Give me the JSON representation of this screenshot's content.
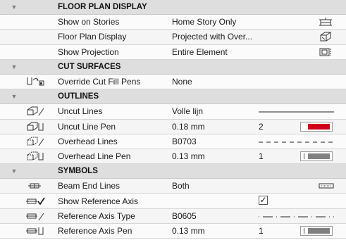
{
  "sections": [
    {
      "title": "FLOOR PLAN DISPLAY",
      "rows": [
        {
          "label": "Show on Stories",
          "value": "Home Story Only",
          "right_icon": "story-icon"
        },
        {
          "label": "Floor Plan Display",
          "value": "Projected with Over...",
          "right_icon": "projected-overhead-icon"
        },
        {
          "label": "Show Projection",
          "value": "Entire Element",
          "right_icon": "entire-element-icon"
        }
      ]
    },
    {
      "title": "CUT SURFACES",
      "rows": [
        {
          "label": "Override Cut Fill Pens",
          "value": "None",
          "left_icon": "override-fill-pens-icon"
        }
      ]
    },
    {
      "title": "OUTLINES",
      "rows": [
        {
          "label": "Uncut Lines",
          "value": "Volle lijn",
          "left_icon": "uncut-lines-icon",
          "line_style": "solid"
        },
        {
          "label": "Uncut Line Pen",
          "value": "0.18 mm",
          "left_icon": "uncut-line-pen-icon",
          "pen_number": "2",
          "pen_color": "#d0021b"
        },
        {
          "label": "Overhead Lines",
          "value": "B0703",
          "left_icon": "overhead-lines-icon",
          "line_style": "dashed"
        },
        {
          "label": "Overhead Line Pen",
          "value": "0.13 mm",
          "left_icon": "overhead-line-pen-icon",
          "pen_number": "1",
          "pen_color": "#808080"
        }
      ]
    },
    {
      "title": "SYMBOLS",
      "rows": [
        {
          "label": "Beam End Lines",
          "value": "Both",
          "left_icon": "beam-end-lines-icon",
          "right_icon": "beam-end-both-icon"
        },
        {
          "label": "Show Reference Axis",
          "value": "",
          "left_icon": "show-reference-axis-icon",
          "checked": true,
          "check_glyph": "✓"
        },
        {
          "label": "Reference Axis Type",
          "value": "B0605",
          "left_icon": "reference-axis-type-icon",
          "line_style": "dash-dot"
        },
        {
          "label": "Reference Axis Pen",
          "value": "0.13 mm",
          "left_icon": "reference-axis-pen-icon",
          "pen_number": "1",
          "pen_color": "#808080"
        }
      ]
    }
  ],
  "toggle_glyph": "▼"
}
